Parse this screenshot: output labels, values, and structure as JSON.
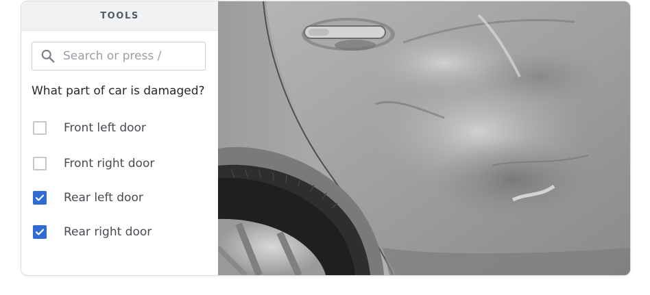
{
  "panel": {
    "header": "TOOLS",
    "search": {
      "placeholder": "Search or press /",
      "value": ""
    },
    "question": "What part of car is damaged?",
    "options": [
      {
        "label": "Front left door",
        "checked": false
      },
      {
        "label": "Front right door",
        "checked": false
      },
      {
        "label": "Rear left door",
        "checked": true
      },
      {
        "label": "Rear right door",
        "checked": true
      }
    ]
  },
  "colors": {
    "accent": "#2f6bd3",
    "header_bg": "#f1f2f4"
  },
  "icons": {
    "search": "search-icon",
    "check": "checkmark-icon"
  }
}
